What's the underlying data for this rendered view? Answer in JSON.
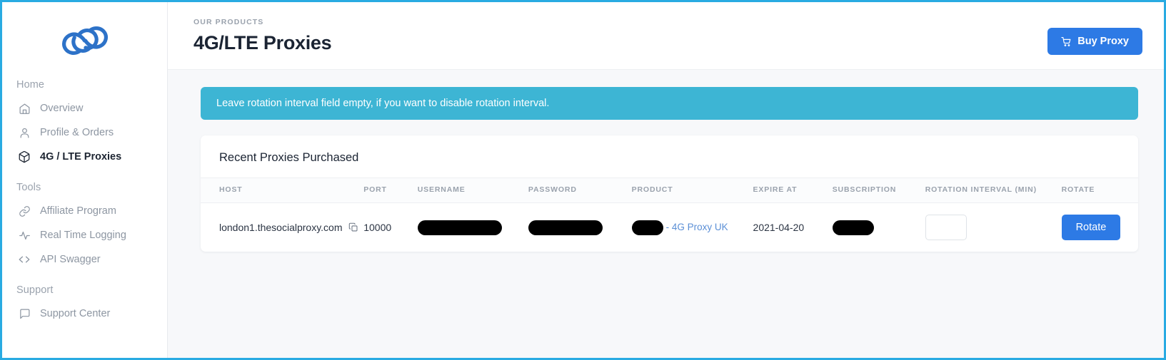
{
  "brand": {
    "logo_icon": "spiral-links-logo",
    "accent_blue": "#2d7ae5",
    "logo_blue": "#2d72c8",
    "alert_cyan": "#3db5d4",
    "link_blue": "#5b8fd6",
    "page_bg": "#f7f8fa",
    "border_cyan": "#29abe2"
  },
  "sidebar": {
    "sections": [
      {
        "title": "Home",
        "items": [
          {
            "label": "Overview",
            "icon": "home-icon",
            "active": false
          },
          {
            "label": "Profile & Orders",
            "icon": "user-icon",
            "active": false
          },
          {
            "label": "4G / LTE Proxies",
            "icon": "box-icon",
            "active": true
          }
        ]
      },
      {
        "title": "Tools",
        "items": [
          {
            "label": "Affiliate Program",
            "icon": "link-icon",
            "active": false
          },
          {
            "label": "Real Time Logging",
            "icon": "activity-icon",
            "active": false
          },
          {
            "label": "API Swagger",
            "icon": "code-icon",
            "active": false
          }
        ]
      },
      {
        "title": "Support",
        "items": [
          {
            "label": "Support Center",
            "icon": "message-square-icon",
            "active": false
          }
        ]
      }
    ]
  },
  "header": {
    "eyebrow": "OUR PRODUCTS",
    "title": "4G/LTE Proxies",
    "buy_button": {
      "label": "Buy Proxy",
      "icon": "shopping-cart-icon"
    }
  },
  "alert": {
    "message": "Leave rotation interval field empty, if you want to disable rotation interval."
  },
  "table": {
    "card_title": "Recent Proxies Purchased",
    "columns": [
      "HOST",
      "PORT",
      "USERNAME",
      "PASSWORD",
      "PRODUCT",
      "EXPIRE AT",
      "SUBSCRIPTION",
      "ROTATION INTERVAL (MIN)",
      "ROTATE"
    ],
    "rows": [
      {
        "host": "london1.thesocialproxy.com",
        "host_copy_icon": "copy-icon",
        "port": "10000",
        "username": "[redacted]",
        "password": "[redacted]",
        "product_redacted": "[redacted]",
        "product_link": "- 4G Proxy UK",
        "expire_at": "2021-04-20",
        "subscription": "[redacted]",
        "rotation_interval_value": "",
        "rotation_interval_placeholder": "",
        "rotate_label": "Rotate"
      }
    ]
  }
}
